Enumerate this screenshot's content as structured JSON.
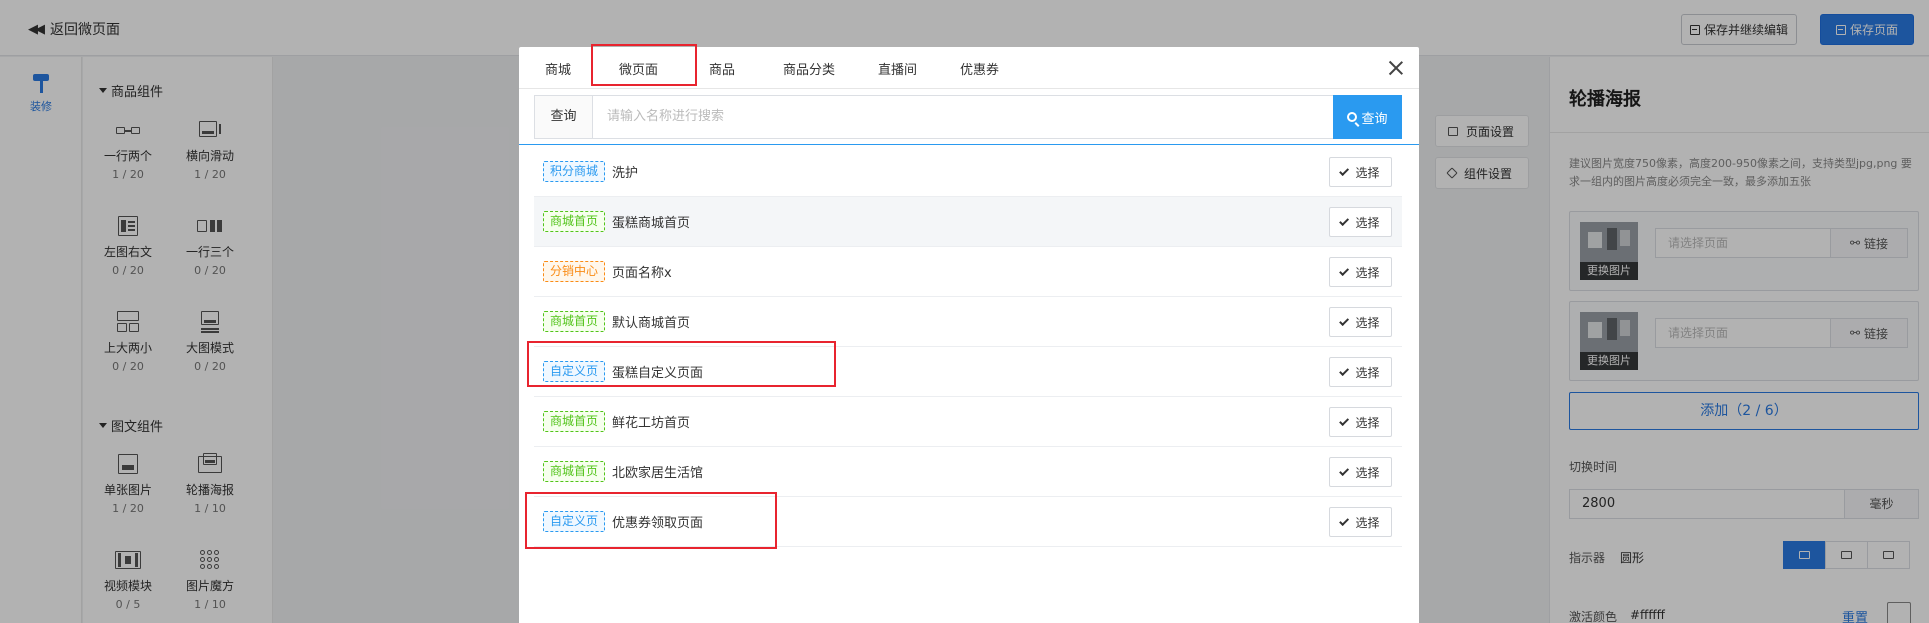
{
  "topbar": {
    "back_label": "返回微页面",
    "save_continue_label": "保存并继续编辑",
    "save_page_label": "保存页面"
  },
  "leftnav": {
    "decorate_label": "装修"
  },
  "palette": {
    "groups": [
      {
        "title": "商品组件",
        "items": [
          {
            "label": "一行两个",
            "count": "1 / 20"
          },
          {
            "label": "横向滑动",
            "count": "1 / 20"
          },
          {
            "label": "左图右文",
            "count": "0 / 20"
          },
          {
            "label": "一行三个",
            "count": "0 / 20"
          },
          {
            "label": "上大两小",
            "count": "0 / 20"
          },
          {
            "label": "大图模式",
            "count": "0 / 20"
          }
        ]
      },
      {
        "title": "图文组件",
        "items": [
          {
            "label": "单张图片",
            "count": "1 / 20"
          },
          {
            "label": "轮播海报",
            "count": "1 / 10"
          },
          {
            "label": "视频模块",
            "count": "0 / 5"
          },
          {
            "label": "图片魔方",
            "count": "1 / 10"
          }
        ]
      }
    ]
  },
  "canvas": {
    "page_settings_label": "页面设置",
    "component_settings_label": "组件设置"
  },
  "props": {
    "title": "轮播海报",
    "hint": "建议图片宽度750像素，高度200-950像素之间，支持类型jpg,png 要求一组内的图片高度必须完全一致，最多添加五张",
    "posters": [
      {
        "change_label": "更换图片",
        "page_placeholder": "请选择页面",
        "link_label": "链接"
      },
      {
        "change_label": "更换图片",
        "page_placeholder": "请选择页面",
        "link_label": "链接"
      }
    ],
    "add_label": "添加（2 / 6）",
    "interval_label": "切换时间",
    "interval_value": "2800",
    "interval_unit": "毫秒",
    "indicator_label": "指示器",
    "indicator_value": "圆形",
    "active_color_label": "激活颜色",
    "active_color_value": "#ffffff",
    "reset_label": "重置"
  },
  "modal": {
    "tabs": [
      "商城",
      "微页面",
      "商品",
      "商品分类",
      "直播间",
      "优惠券"
    ],
    "active_tab": "微页面",
    "search_label": "查询",
    "search_placeholder": "请输入名称进行搜索",
    "search_button": "查询",
    "choose_label": "选择",
    "rows": [
      {
        "tag": "积分商城",
        "tag_color": "blue",
        "name": "洗护"
      },
      {
        "tag": "商城首页",
        "tag_color": "green",
        "name": "蛋糕商城首页"
      },
      {
        "tag": "分销中心",
        "tag_color": "orange",
        "name": "页面名称x"
      },
      {
        "tag": "商城首页",
        "tag_color": "green",
        "name": "默认商城首页"
      },
      {
        "tag": "自定义页",
        "tag_color": "blue",
        "name": "蛋糕自定义页面"
      },
      {
        "tag": "商城首页",
        "tag_color": "green",
        "name": "鲜花工坊首页"
      },
      {
        "tag": "商城首页",
        "tag_color": "green",
        "name": "北欧家居生活馆"
      },
      {
        "tag": "自定义页",
        "tag_color": "blue",
        "name": "优惠券领取页面"
      }
    ]
  },
  "colors": {
    "primary": "#2a7ae2",
    "search_button": "#2a9af0",
    "highlight": "#e8242f",
    "tag_blue": "#2a9af0",
    "tag_green": "#52c41a",
    "tag_orange": "#fa8c16"
  }
}
